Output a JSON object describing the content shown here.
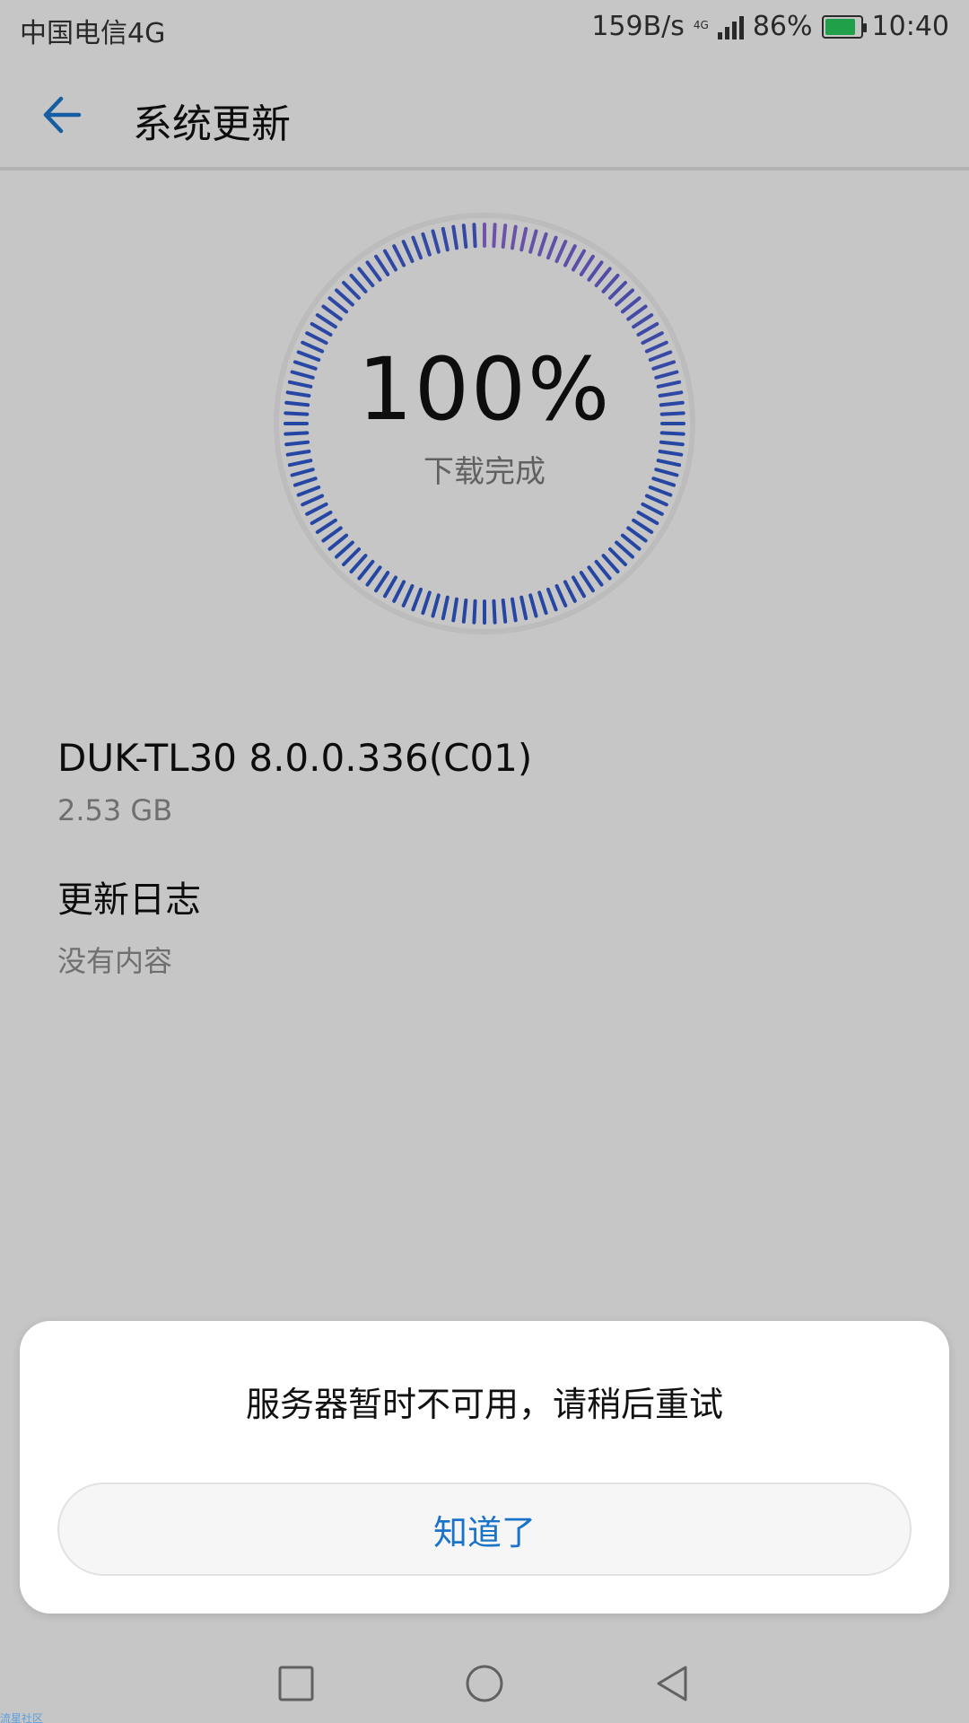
{
  "status_bar": {
    "carrier": "中国电信4G",
    "net_speed": "159B/s",
    "network_type": "4G",
    "battery_percent": "86%",
    "battery_level": 0.86,
    "time": "10:40",
    "battery_color": "#29c45b"
  },
  "header": {
    "title": "系统更新",
    "back_icon": "arrow-left-icon",
    "accent": "#1a73c9"
  },
  "progress": {
    "percent_text": "100%",
    "value": 1.0,
    "status": "下载完成",
    "colors": [
      "#2f56c9",
      "#8a66cf"
    ]
  },
  "update": {
    "version": "DUK-TL30 8.0.0.336(C01)",
    "size": "2.53 GB",
    "log_title": "更新日志",
    "log_content": "没有内容"
  },
  "dialog": {
    "message": "服务器暂时不可用，请稍后重试",
    "button": "知道了"
  },
  "navigation": {
    "icons": [
      "square-icon",
      "circle-icon",
      "triangle-back-icon"
    ]
  },
  "watermark": "流星社区"
}
